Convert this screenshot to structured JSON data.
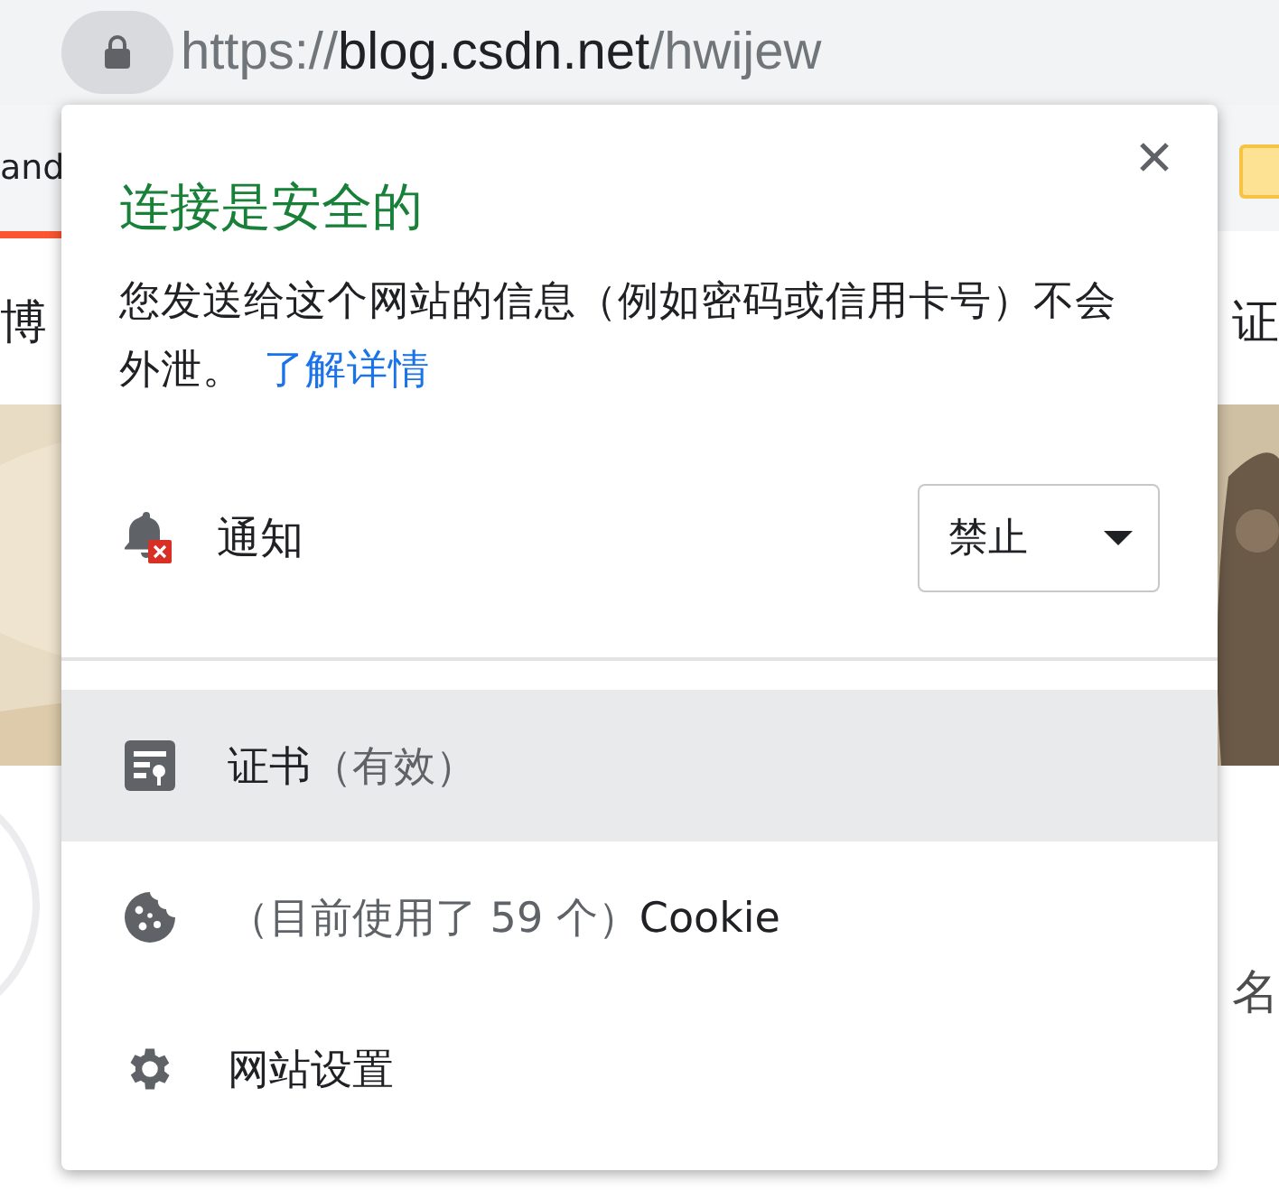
{
  "address_bar": {
    "scheme": "https://",
    "host": "blog.csdn.net",
    "path": "/hwijew"
  },
  "background_page": {
    "bookmark_label": "and",
    "top_left_text": "博",
    "top_right_text": "证",
    "lower_right_text": "名"
  },
  "popup": {
    "title": "连接是安全的",
    "description": "您发送给这个网站的信息（例如密码或信用卡号）不会外泄。",
    "learn_more_link": "了解详情",
    "permission": {
      "label": "通知",
      "value": "禁止"
    },
    "items": [
      {
        "kind": "certificate",
        "highlighted": true,
        "segments": [
          {
            "text": "证书",
            "muted": false
          },
          {
            "text": "（有效）",
            "muted": true
          }
        ]
      },
      {
        "kind": "cookies",
        "highlighted": false,
        "segments": [
          {
            "text": "（目前使用了 59 个）",
            "muted": true
          },
          {
            "text": "Cookie",
            "muted": false
          }
        ]
      },
      {
        "kind": "settings",
        "highlighted": false,
        "segments": [
          {
            "text": "网站设置",
            "muted": false
          }
        ]
      }
    ]
  }
}
